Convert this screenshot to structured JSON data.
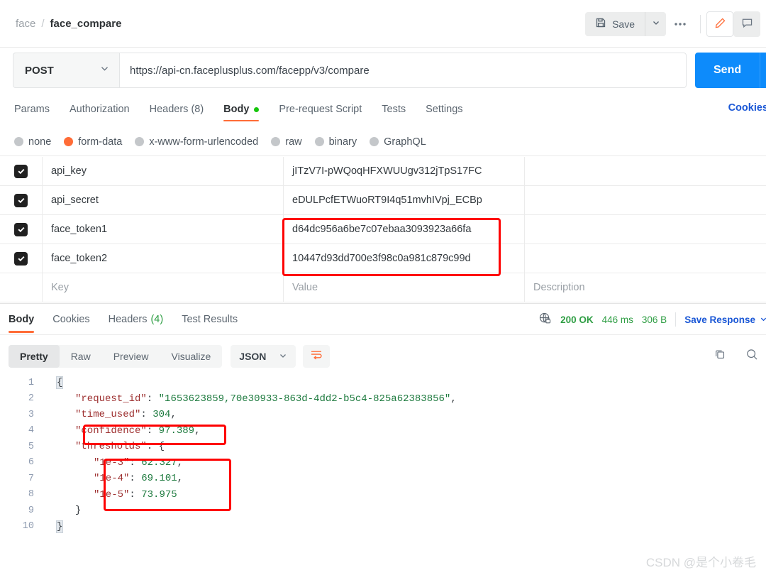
{
  "breadcrumb": {
    "collection": "face",
    "separator": "/",
    "current": "face_compare"
  },
  "toolbar": {
    "save_label": "Save",
    "more_label": "●●●",
    "save_icon": "floppy-disk-icon",
    "caret_icon": "chevron-down-icon",
    "edit_icon": "pencil-icon",
    "comment_icon": "comment-icon",
    "accent_orange": "#ff6c37"
  },
  "url_bar": {
    "method": "POST",
    "url": "https://api-cn.faceplusplus.com/facepp/v3/compare",
    "send_label": "Send",
    "send_color": "#0d8bfb"
  },
  "request_tabs": {
    "items": [
      {
        "label": "Params",
        "active": false
      },
      {
        "label": "Authorization",
        "active": false
      },
      {
        "label": "Headers (8)",
        "active": false
      },
      {
        "label": "Body",
        "active": true,
        "dot": true
      },
      {
        "label": "Pre-request Script",
        "active": false
      },
      {
        "label": "Tests",
        "active": false
      },
      {
        "label": "Settings",
        "active": false
      }
    ],
    "cookies_link": "Cookies"
  },
  "body_types": {
    "options": [
      {
        "label": "none",
        "selected": false
      },
      {
        "label": "form-data",
        "selected": true
      },
      {
        "label": "x-www-form-urlencoded",
        "selected": false
      },
      {
        "label": "raw",
        "selected": false
      },
      {
        "label": "binary",
        "selected": false
      },
      {
        "label": "GraphQL",
        "selected": false
      }
    ]
  },
  "params_table": {
    "rows": [
      {
        "checked": true,
        "key": "api_key",
        "value": "jITzV7I-pWQoqHFXWUUgv312jTpS17FC",
        "description": ""
      },
      {
        "checked": true,
        "key": "api_secret",
        "value": "eDULPcfETWuoRT9I4q51mvhIVpj_ECBp",
        "description": ""
      },
      {
        "checked": true,
        "key": "face_token1",
        "value": "d64dc956a6be7c07ebaa3093923a66fa",
        "description": ""
      },
      {
        "checked": true,
        "key": "face_token2",
        "value": "10447d93dd700e3f98c0a981c879c99d",
        "description": ""
      }
    ],
    "placeholders": {
      "key": "Key",
      "value": "Value",
      "description": "Description"
    }
  },
  "response_tabs": {
    "items": [
      {
        "label": "Body",
        "active": true
      },
      {
        "label": "Cookies",
        "active": false
      },
      {
        "label": "Headers",
        "count": "(4)",
        "active": false
      },
      {
        "label": "Test Results",
        "active": false
      }
    ],
    "status": "200 OK",
    "time": "446 ms",
    "size": "306 B",
    "save_response": "Save Response",
    "globe_icon": "globe-lock-icon"
  },
  "view_toolbar": {
    "modes": [
      {
        "label": "Pretty",
        "active": true
      },
      {
        "label": "Raw",
        "active": false
      },
      {
        "label": "Preview",
        "active": false
      },
      {
        "label": "Visualize",
        "active": false
      }
    ],
    "format": "JSON",
    "wrap_icon": "word-wrap-icon",
    "copy_icon": "copy-icon",
    "search_icon": "search-icon"
  },
  "response_body": {
    "lines": [
      {
        "no": "1",
        "indent": 0,
        "segments": [
          {
            "t": "{",
            "c": "brace"
          }
        ]
      },
      {
        "no": "2",
        "indent": 1,
        "segments": [
          {
            "t": "\"request_id\"",
            "c": "key"
          },
          {
            "t": ": ",
            "c": "punc"
          },
          {
            "t": "\"1653623859,70e30933-863d-4dd2-b5c4-825a62383856\"",
            "c": "str"
          },
          {
            "t": ",",
            "c": "punc"
          }
        ]
      },
      {
        "no": "3",
        "indent": 1,
        "segments": [
          {
            "t": "\"time_used\"",
            "c": "key"
          },
          {
            "t": ": ",
            "c": "punc"
          },
          {
            "t": "304",
            "c": "num"
          },
          {
            "t": ",",
            "c": "punc"
          }
        ]
      },
      {
        "no": "4",
        "indent": 1,
        "segments": [
          {
            "t": "\"confidence\"",
            "c": "key"
          },
          {
            "t": ": ",
            "c": "punc"
          },
          {
            "t": "97.389",
            "c": "num"
          },
          {
            "t": ",",
            "c": "punc"
          }
        ]
      },
      {
        "no": "5",
        "indent": 1,
        "segments": [
          {
            "t": "\"thresholds\"",
            "c": "key"
          },
          {
            "t": ": ",
            "c": "punc"
          },
          {
            "t": "{",
            "c": "punc"
          }
        ]
      },
      {
        "no": "6",
        "indent": 2,
        "segments": [
          {
            "t": "\"1e-3\"",
            "c": "key"
          },
          {
            "t": ": ",
            "c": "punc"
          },
          {
            "t": "62.327",
            "c": "num"
          },
          {
            "t": ",",
            "c": "punc"
          }
        ]
      },
      {
        "no": "7",
        "indent": 2,
        "segments": [
          {
            "t": "\"1e-4\"",
            "c": "key"
          },
          {
            "t": ": ",
            "c": "punc"
          },
          {
            "t": "69.101",
            "c": "num"
          },
          {
            "t": ",",
            "c": "punc"
          }
        ]
      },
      {
        "no": "8",
        "indent": 2,
        "segments": [
          {
            "t": "\"1e-5\"",
            "c": "key"
          },
          {
            "t": ": ",
            "c": "punc"
          },
          {
            "t": "73.975",
            "c": "num"
          }
        ]
      },
      {
        "no": "9",
        "indent": 1,
        "segments": [
          {
            "t": "}",
            "c": "punc"
          }
        ]
      },
      {
        "no": "10",
        "indent": 0,
        "segments": [
          {
            "t": "}",
            "c": "brace"
          }
        ]
      }
    ],
    "values": {
      "request_id": "1653623859,70e30933-863d-4dd2-b5c4-825a62383856",
      "time_used": 304,
      "confidence": 97.389,
      "thresholds": {
        "1e-3": 62.327,
        "1e-4": 69.101,
        "1e-5": 73.975
      }
    }
  },
  "annotations": {
    "color": "#fe0000",
    "boxes": [
      "face-token-values",
      "confidence-line",
      "thresholds-block"
    ]
  },
  "watermark": "CSDN @是个小卷毛"
}
